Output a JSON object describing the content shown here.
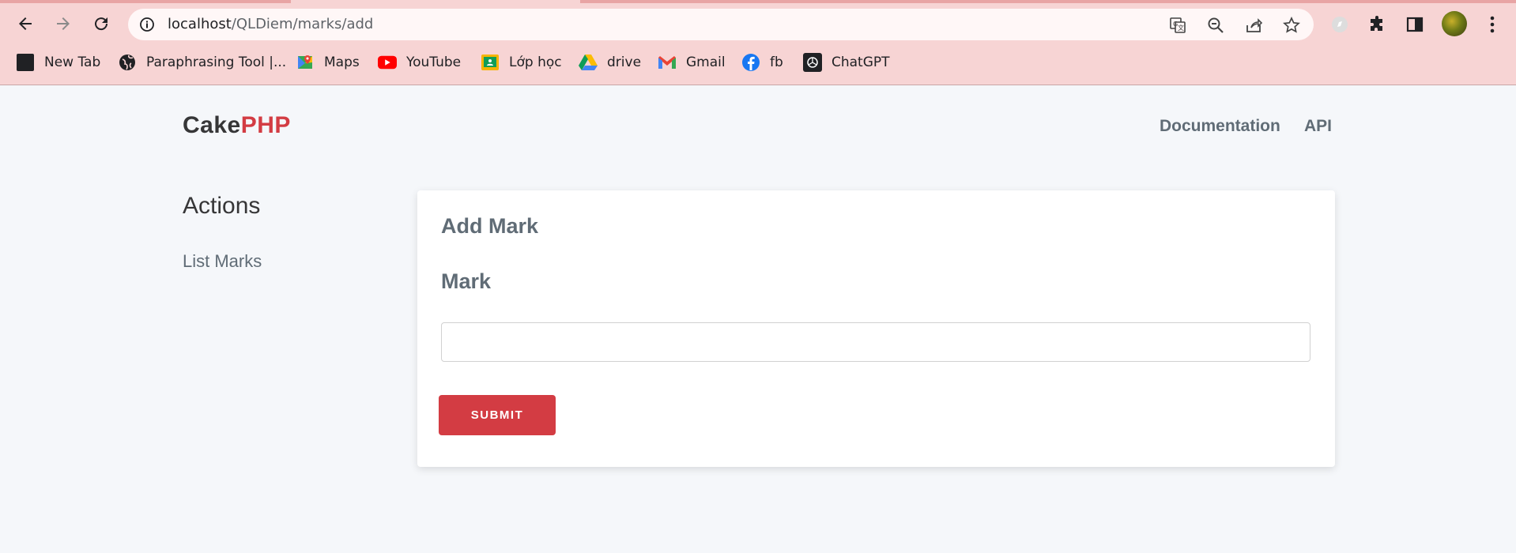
{
  "browser": {
    "url_host": "localhost",
    "url_path": "/QLDiem/marks/add",
    "bookmarks": [
      {
        "label": "New Tab",
        "icon": "new-tab-icon"
      },
      {
        "label": "Paraphrasing Tool |...",
        "icon": "globe-icon"
      },
      {
        "label": "Maps",
        "icon": "maps-icon"
      },
      {
        "label": "YouTube",
        "icon": "youtube-icon"
      },
      {
        "label": "Lớp học",
        "icon": "classroom-icon"
      },
      {
        "label": "drive",
        "icon": "drive-icon"
      },
      {
        "label": "Gmail",
        "icon": "gmail-icon"
      },
      {
        "label": "fb",
        "icon": "facebook-icon"
      },
      {
        "label": "ChatGPT",
        "icon": "chatgpt-icon"
      }
    ],
    "colors": {
      "chrome_bg": "#f7d4d4"
    }
  },
  "header": {
    "brand_cake": "Cake",
    "brand_php": "PHP",
    "nav": {
      "documentation": "Documentation",
      "api": "API"
    }
  },
  "sidebar": {
    "heading": "Actions",
    "links": [
      {
        "label": "List Marks"
      }
    ]
  },
  "form": {
    "title": "Add Mark",
    "field_label": "Mark",
    "field_value": "",
    "submit_label": "SUBMIT"
  },
  "colors": {
    "accent": "#d33c43",
    "text_muted": "#606c76",
    "page_bg": "#f5f7fa"
  }
}
